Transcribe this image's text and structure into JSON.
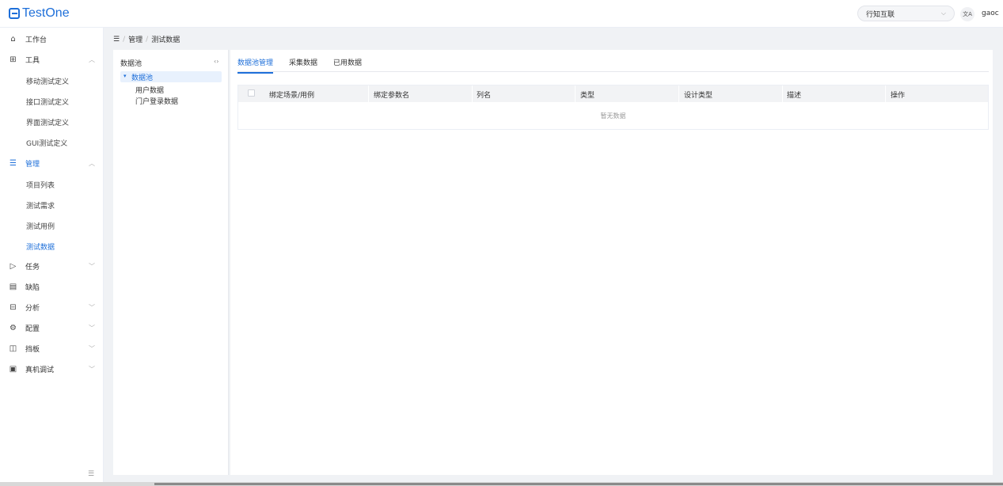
{
  "app": {
    "logo": "TestOne"
  },
  "header": {
    "org": "行知互联",
    "lang": "文A",
    "user": "gaoc"
  },
  "sidebar": {
    "items": [
      {
        "label": "工作台"
      },
      {
        "label": "工具"
      },
      {
        "label": "管理"
      },
      {
        "label": "任务"
      },
      {
        "label": "缺陷"
      },
      {
        "label": "分析"
      },
      {
        "label": "配置"
      },
      {
        "label": "挡板"
      },
      {
        "label": "真机调试"
      }
    ],
    "tools_sub": [
      "移动测试定义",
      "接口测试定义",
      "界面测试定义",
      "GUI测试定义"
    ],
    "manage_sub": [
      "项目列表",
      "测试需求",
      "测试用例",
      "测试数据"
    ]
  },
  "breadcrumb": {
    "menu": "☰",
    "items": [
      "管理",
      "测试数据"
    ],
    "sep": "/"
  },
  "tree": {
    "title": "数据池",
    "toggle": "‹›",
    "root": "数据池",
    "children": [
      "用户数据",
      "门户登录数据"
    ]
  },
  "tabs": [
    "数据池管理",
    "采集数据",
    "已用数据"
  ],
  "table": {
    "columns": [
      "绑定场景/用例",
      "绑定参数名",
      "列名",
      "类型",
      "设计类型",
      "描述",
      "操作"
    ],
    "empty_text": "暂无数据"
  }
}
